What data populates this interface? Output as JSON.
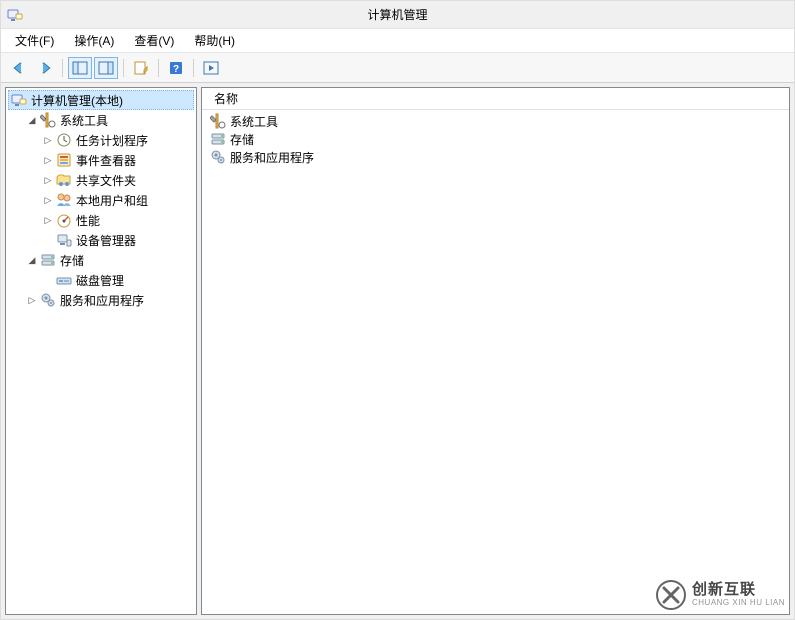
{
  "window": {
    "title": "计算机管理"
  },
  "menu": {
    "file": "文件(F)",
    "action": "操作(A)",
    "view": "查看(V)",
    "help": "帮助(H)"
  },
  "tree": {
    "root": "计算机管理(本地)",
    "system_tools": "系统工具",
    "task_scheduler": "任务计划程序",
    "event_viewer": "事件查看器",
    "shared_folders": "共享文件夹",
    "local_users": "本地用户和组",
    "performance": "性能",
    "device_manager": "设备管理器",
    "storage": "存储",
    "disk_management": "磁盘管理",
    "services_apps": "服务和应用程序"
  },
  "list": {
    "header_name": "名称",
    "rows": {
      "r0": "系统工具",
      "r1": "存储",
      "r2": "服务和应用程序"
    }
  },
  "watermark": {
    "cn": "创新互联",
    "en": "CHUANG XIN HU LIAN"
  }
}
